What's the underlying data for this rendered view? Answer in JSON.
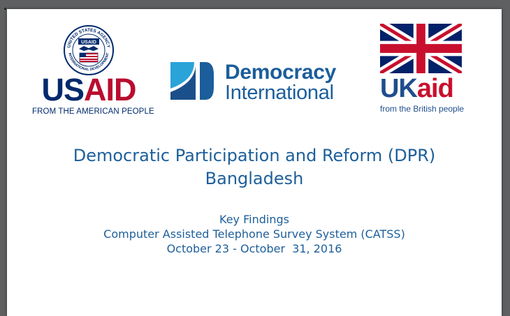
{
  "logos": {
    "usaid": {
      "seal_text_top": "UNITED STATES AGENCY",
      "seal_text_bottom": "INTERNATIONAL DEVELOPMENT",
      "seal_label": "USAID",
      "word_us": "US",
      "word_aid": "AID",
      "tagline": "FROM THE AMERICAN PEOPLE",
      "colors": {
        "blue": "#002a6c",
        "red": "#ba0c2f"
      }
    },
    "democracy_international": {
      "line1": "Democracy",
      "line2": "International",
      "color": "#1b5e9b"
    },
    "ukaid": {
      "word_uk": "UK",
      "word_aid": "aid",
      "tagline": "from the British people",
      "colors": {
        "blue": "#1f4e8c",
        "red": "#c8102e"
      }
    }
  },
  "title": {
    "line1": "Democratic Participation and Reform (DPR)",
    "line2": "Bangladesh"
  },
  "subtitle": {
    "line1": "Key Findings",
    "line2": "Computer Assisted Telephone Survey System (CATSS)",
    "line3": "October 23 - October  31, 2016"
  },
  "text_color": "#1d5f9a"
}
